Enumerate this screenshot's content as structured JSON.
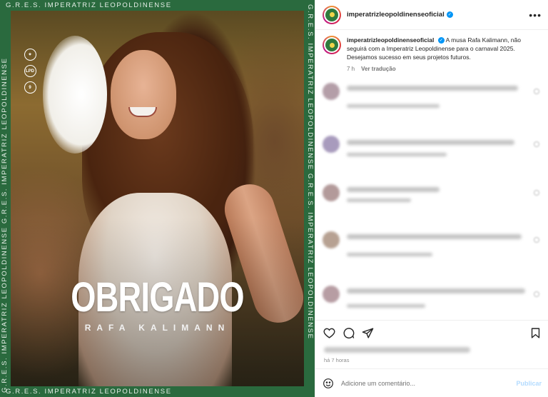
{
  "media": {
    "frame_text": "G.R.E.S. IMPERATRIZ LEOPOLDINENSE G.R.E.S. IMPERATRIZ LEOPOLDINENSE",
    "frame_text_top": "G.R.E.S. IMPERATRIZ LEOPOLDINENSE",
    "frame_text_bottom": "G.R.E.S. IMPERATRIZ LEOPOLDINENSE",
    "headline": "OBRIGADO",
    "subline": "RAFA KALIMANN",
    "badges": [
      "✦",
      "LPD",
      "9"
    ],
    "frame_color": "#2a6a3e"
  },
  "post": {
    "username": "imperatrizleopoldinenseoficial",
    "verified": "✓",
    "more_icon": "•••",
    "caption_username": "imperatrizleopoldinenseoficial",
    "caption_text": "A musa Rafa Kalimann, não seguirá com a Imperatriz Leopoldinense para o carnaval 2025. Desejamos sucesso em seus projetos futuros.",
    "caption_age": "7 h",
    "translate_label": "Ver tradução",
    "time_ago": "há 7 horas",
    "comment_placeholder": "Adicione um comentário...",
    "publish_label": "Publicar",
    "accent": "#0095f6"
  }
}
